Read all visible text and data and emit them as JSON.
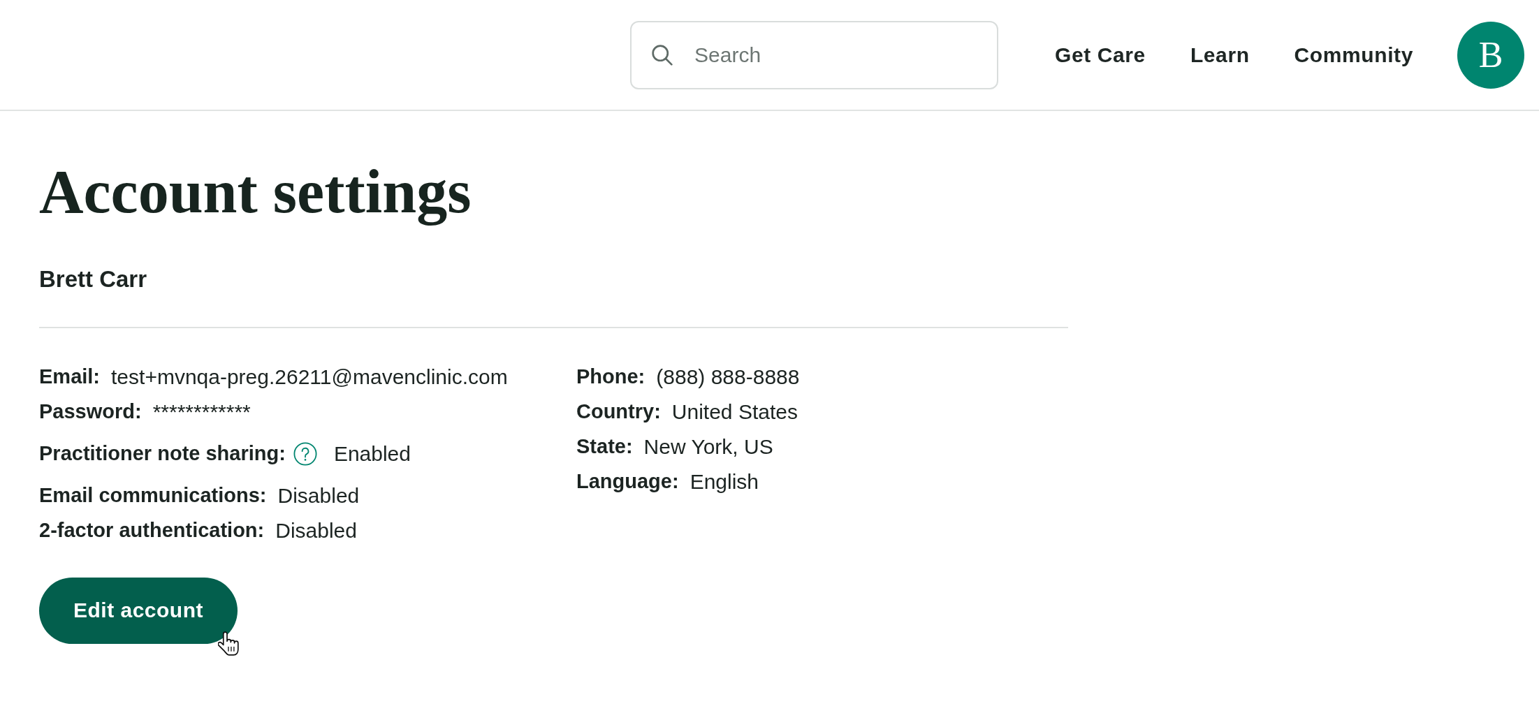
{
  "header": {
    "search": {
      "placeholder": "Search"
    },
    "nav": [
      "Get Care",
      "Learn",
      "Community"
    ],
    "avatar": {
      "initial": "B"
    }
  },
  "page": {
    "title": "Account settings",
    "user_name": "Brett Carr",
    "details": {
      "columns": [
        {
          "rows": [
            {
              "label": "Email:",
              "value": "test+mvnqa-preg.26211@mavenclinic.com",
              "help_icon": false
            },
            {
              "label": "Password:",
              "value": "************",
              "help_icon": false
            },
            {
              "label": "Practitioner note sharing:",
              "value": "Enabled",
              "help_icon": true
            },
            {
              "label": "Email communications:",
              "value": "Disabled",
              "help_icon": false
            },
            {
              "label": "2-factor authentication:",
              "value": "Disabled",
              "help_icon": false
            }
          ]
        },
        {
          "rows": [
            {
              "label": "Phone:",
              "value": "(888) 888-8888",
              "help_icon": false
            },
            {
              "label": "Country:",
              "value": "United States",
              "help_icon": false
            },
            {
              "label": "State:",
              "value": "New York, US",
              "help_icon": false
            },
            {
              "label": "Language:",
              "value": "English",
              "help_icon": false
            }
          ]
        }
      ]
    },
    "edit_button": "Edit account"
  }
}
